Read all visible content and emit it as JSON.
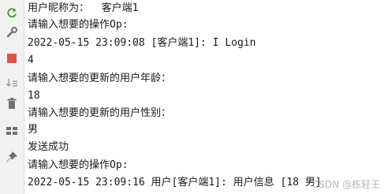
{
  "toolbar": {
    "icons": [
      "rerun-icon",
      "wrench-icon",
      "stop-icon",
      "sort-icon",
      "trash-icon",
      "layout-icon",
      "pin-icon"
    ],
    "colors": {
      "rerun": "#4e9a3a",
      "stop": "#d9534f",
      "gray": "#707070"
    }
  },
  "console": {
    "lines": [
      "用户昵称为：  客户端1",
      "请输入想要的操作Op:",
      "2022-05-15 23:09:08 [客户端1]: I Login",
      "4",
      "请输入想要的更新的用户年龄：",
      "18",
      "请输入想要的更新的用户性别：",
      "男",
      "发送成功",
      "请输入想要的操作Op:",
      "2022-05-15 23:09:16 用户[客户端1]: 用户信息 [18 男]"
    ]
  },
  "watermark": "CSDN @栋轻王"
}
